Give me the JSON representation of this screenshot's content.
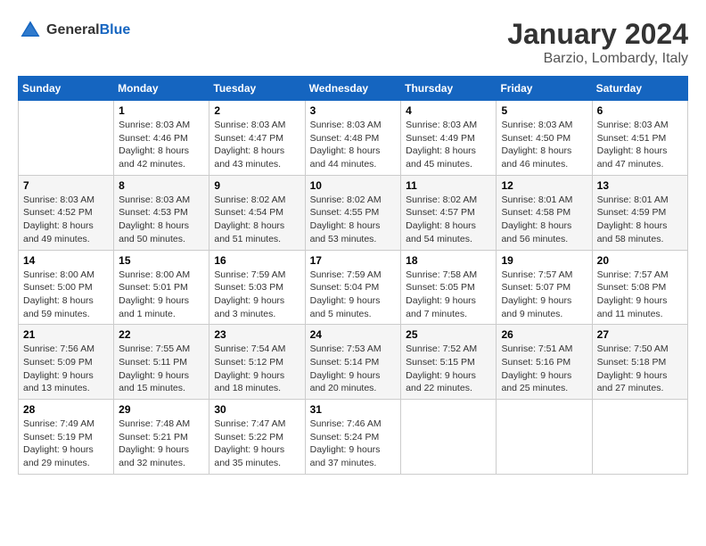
{
  "header": {
    "logo_general": "General",
    "logo_blue": "Blue",
    "month_title": "January 2024",
    "location": "Barzio, Lombardy, Italy"
  },
  "weekdays": [
    "Sunday",
    "Monday",
    "Tuesday",
    "Wednesday",
    "Thursday",
    "Friday",
    "Saturday"
  ],
  "weeks": [
    [
      {
        "day": "",
        "info": ""
      },
      {
        "day": "1",
        "info": "Sunrise: 8:03 AM\nSunset: 4:46 PM\nDaylight: 8 hours\nand 42 minutes."
      },
      {
        "day": "2",
        "info": "Sunrise: 8:03 AM\nSunset: 4:47 PM\nDaylight: 8 hours\nand 43 minutes."
      },
      {
        "day": "3",
        "info": "Sunrise: 8:03 AM\nSunset: 4:48 PM\nDaylight: 8 hours\nand 44 minutes."
      },
      {
        "day": "4",
        "info": "Sunrise: 8:03 AM\nSunset: 4:49 PM\nDaylight: 8 hours\nand 45 minutes."
      },
      {
        "day": "5",
        "info": "Sunrise: 8:03 AM\nSunset: 4:50 PM\nDaylight: 8 hours\nand 46 minutes."
      },
      {
        "day": "6",
        "info": "Sunrise: 8:03 AM\nSunset: 4:51 PM\nDaylight: 8 hours\nand 47 minutes."
      }
    ],
    [
      {
        "day": "7",
        "info": "Sunrise: 8:03 AM\nSunset: 4:52 PM\nDaylight: 8 hours\nand 49 minutes."
      },
      {
        "day": "8",
        "info": "Sunrise: 8:03 AM\nSunset: 4:53 PM\nDaylight: 8 hours\nand 50 minutes."
      },
      {
        "day": "9",
        "info": "Sunrise: 8:02 AM\nSunset: 4:54 PM\nDaylight: 8 hours\nand 51 minutes."
      },
      {
        "day": "10",
        "info": "Sunrise: 8:02 AM\nSunset: 4:55 PM\nDaylight: 8 hours\nand 53 minutes."
      },
      {
        "day": "11",
        "info": "Sunrise: 8:02 AM\nSunset: 4:57 PM\nDaylight: 8 hours\nand 54 minutes."
      },
      {
        "day": "12",
        "info": "Sunrise: 8:01 AM\nSunset: 4:58 PM\nDaylight: 8 hours\nand 56 minutes."
      },
      {
        "day": "13",
        "info": "Sunrise: 8:01 AM\nSunset: 4:59 PM\nDaylight: 8 hours\nand 58 minutes."
      }
    ],
    [
      {
        "day": "14",
        "info": "Sunrise: 8:00 AM\nSunset: 5:00 PM\nDaylight: 8 hours\nand 59 minutes."
      },
      {
        "day": "15",
        "info": "Sunrise: 8:00 AM\nSunset: 5:01 PM\nDaylight: 9 hours\nand 1 minute."
      },
      {
        "day": "16",
        "info": "Sunrise: 7:59 AM\nSunset: 5:03 PM\nDaylight: 9 hours\nand 3 minutes."
      },
      {
        "day": "17",
        "info": "Sunrise: 7:59 AM\nSunset: 5:04 PM\nDaylight: 9 hours\nand 5 minutes."
      },
      {
        "day": "18",
        "info": "Sunrise: 7:58 AM\nSunset: 5:05 PM\nDaylight: 9 hours\nand 7 minutes."
      },
      {
        "day": "19",
        "info": "Sunrise: 7:57 AM\nSunset: 5:07 PM\nDaylight: 9 hours\nand 9 minutes."
      },
      {
        "day": "20",
        "info": "Sunrise: 7:57 AM\nSunset: 5:08 PM\nDaylight: 9 hours\nand 11 minutes."
      }
    ],
    [
      {
        "day": "21",
        "info": "Sunrise: 7:56 AM\nSunset: 5:09 PM\nDaylight: 9 hours\nand 13 minutes."
      },
      {
        "day": "22",
        "info": "Sunrise: 7:55 AM\nSunset: 5:11 PM\nDaylight: 9 hours\nand 15 minutes."
      },
      {
        "day": "23",
        "info": "Sunrise: 7:54 AM\nSunset: 5:12 PM\nDaylight: 9 hours\nand 18 minutes."
      },
      {
        "day": "24",
        "info": "Sunrise: 7:53 AM\nSunset: 5:14 PM\nDaylight: 9 hours\nand 20 minutes."
      },
      {
        "day": "25",
        "info": "Sunrise: 7:52 AM\nSunset: 5:15 PM\nDaylight: 9 hours\nand 22 minutes."
      },
      {
        "day": "26",
        "info": "Sunrise: 7:51 AM\nSunset: 5:16 PM\nDaylight: 9 hours\nand 25 minutes."
      },
      {
        "day": "27",
        "info": "Sunrise: 7:50 AM\nSunset: 5:18 PM\nDaylight: 9 hours\nand 27 minutes."
      }
    ],
    [
      {
        "day": "28",
        "info": "Sunrise: 7:49 AM\nSunset: 5:19 PM\nDaylight: 9 hours\nand 29 minutes."
      },
      {
        "day": "29",
        "info": "Sunrise: 7:48 AM\nSunset: 5:21 PM\nDaylight: 9 hours\nand 32 minutes."
      },
      {
        "day": "30",
        "info": "Sunrise: 7:47 AM\nSunset: 5:22 PM\nDaylight: 9 hours\nand 35 minutes."
      },
      {
        "day": "31",
        "info": "Sunrise: 7:46 AM\nSunset: 5:24 PM\nDaylight: 9 hours\nand 37 minutes."
      },
      {
        "day": "",
        "info": ""
      },
      {
        "day": "",
        "info": ""
      },
      {
        "day": "",
        "info": ""
      }
    ]
  ]
}
